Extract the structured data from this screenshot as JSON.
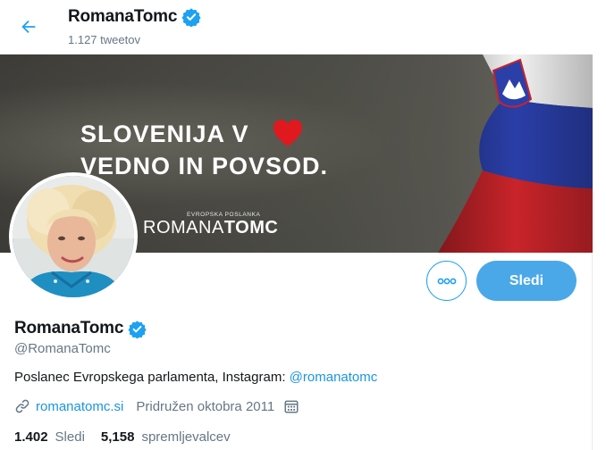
{
  "header": {
    "title": "RomanaTomc",
    "tweet_count": "1.127 tweetov"
  },
  "banner": {
    "line1": "SLOVENIJA V",
    "line2": "VEDNO IN POVSOD.",
    "brand_small": "EVROPSKA POSLANKA",
    "brand_first": "ROMANA",
    "brand_last": "TOMC"
  },
  "actions": {
    "follow_label": "Sledi"
  },
  "profile": {
    "display_name": "RomanaTomc",
    "handle": "@RomanaTomc",
    "bio_text": "Poslanec Evropskega parlamenta, Instagram: ",
    "bio_link": "@romanatomc",
    "website": "romanatomc.si",
    "joined": "Pridružen oktobra 2011",
    "following_count": "1.402",
    "following_label": "Sledi",
    "followers_count": "5,158",
    "followers_label": "spremljevalcev"
  },
  "colors": {
    "accent": "#1da1f2",
    "follow_button": "#4aa8e8",
    "heart": "#e0191f"
  },
  "icons": [
    "back-arrow-icon",
    "verified-badge-icon",
    "more-dots-icon",
    "link-icon",
    "calendar-icon"
  ]
}
